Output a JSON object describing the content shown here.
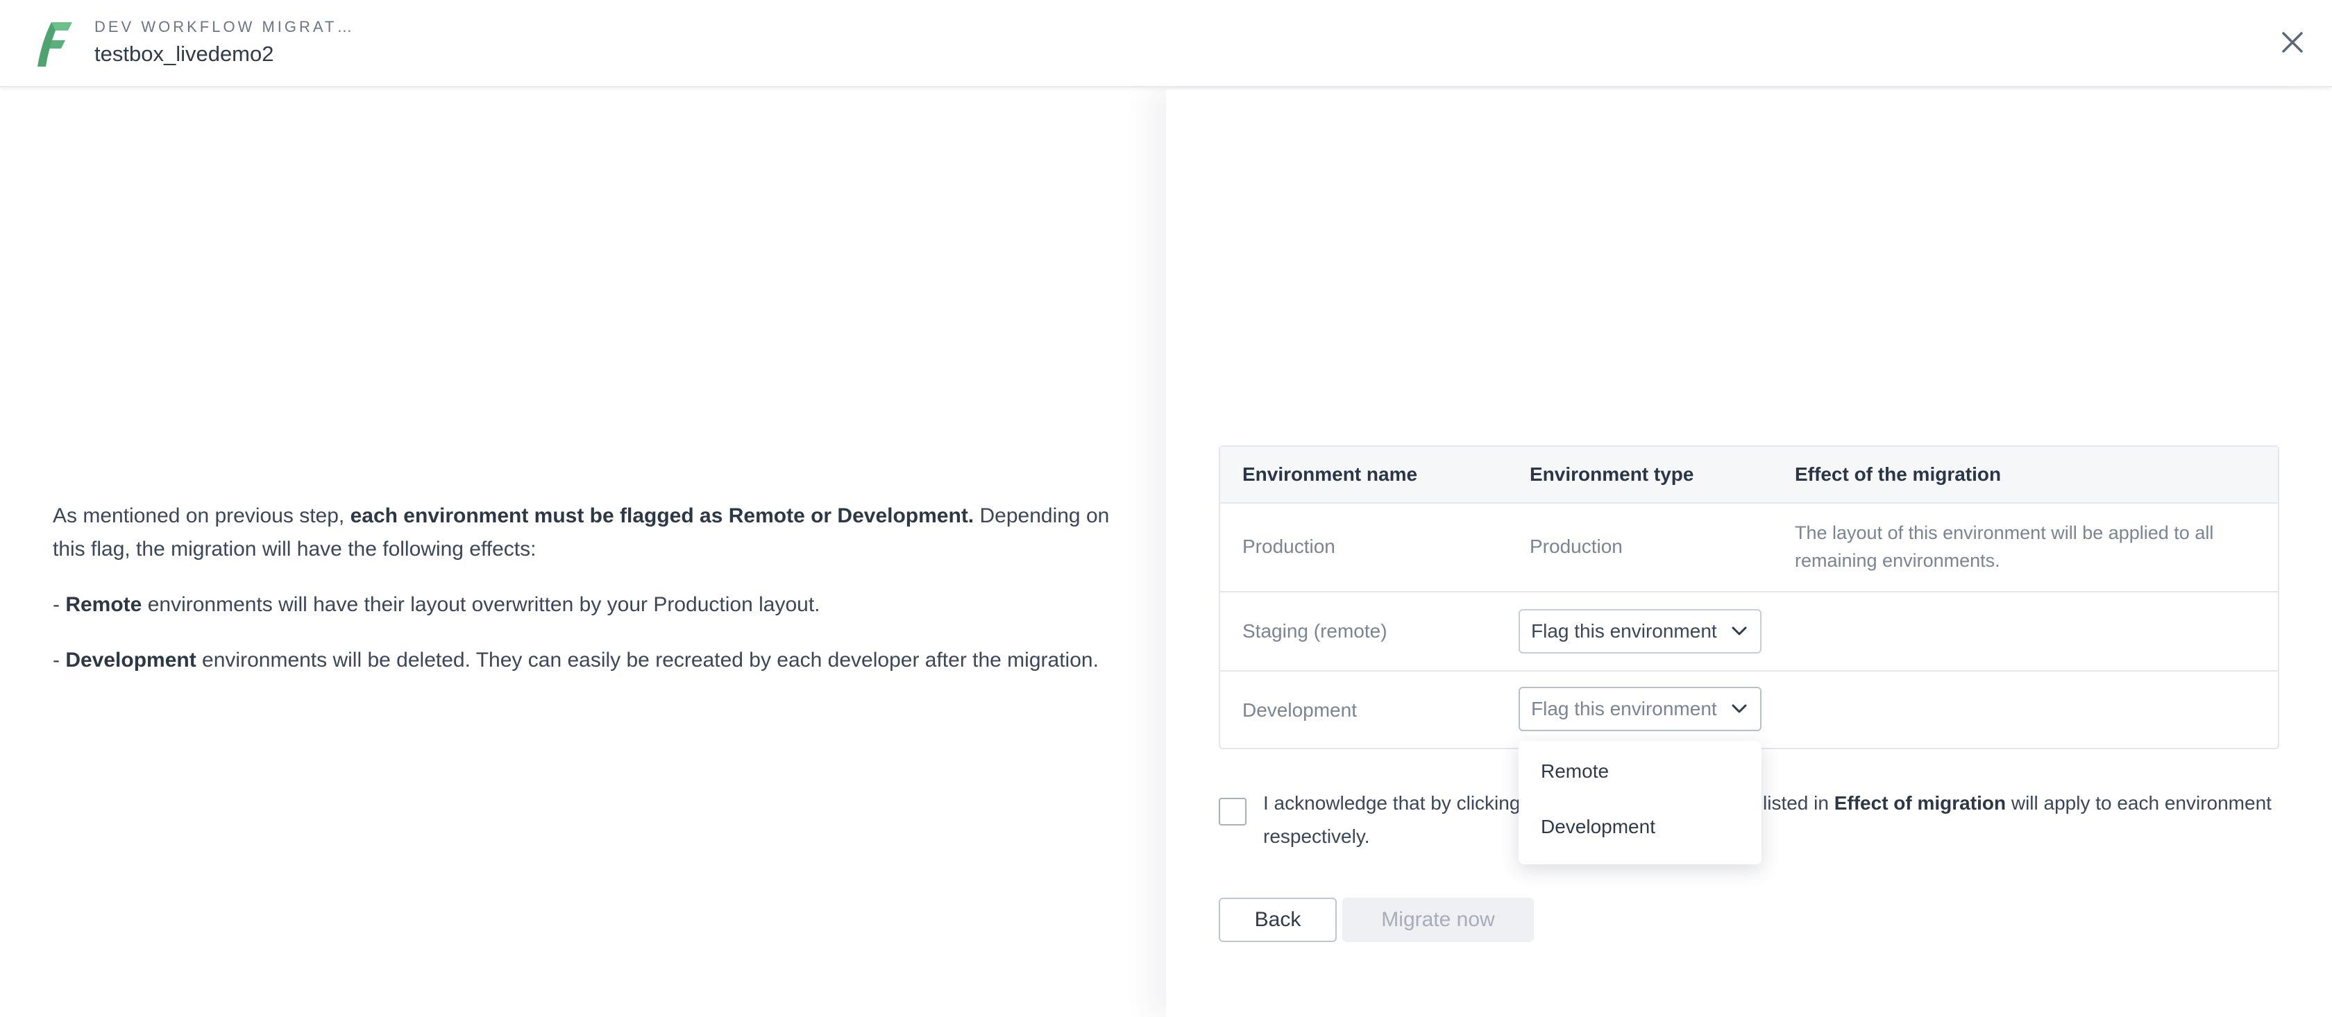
{
  "header": {
    "subtitle": "DEV WORKFLOW MIGRAT…",
    "title": "testbox_livedemo2",
    "brand_color": "#5ab07a",
    "logo_icon": "f-logo-icon",
    "close_icon": "close-icon"
  },
  "intro": {
    "p1_pre": "As mentioned on previous step, ",
    "p1_bold": "each environment must be flagged as Remote or Development.",
    "p1_post": " Depending on this flag, the migration will have the following effects:",
    "p2_dash": "- ",
    "p2_bold": "Remote",
    "p2_post": " environments will have their layout overwritten by your Production layout.",
    "p3_dash": "- ",
    "p3_bold": "Development",
    "p3_post": " environments will be deleted. They can easily be recreated by each developer after the migration."
  },
  "table": {
    "headers": [
      "Environment name",
      "Environment type",
      "Effect of the migration"
    ],
    "rows": [
      {
        "name": "Production",
        "type": "Production",
        "effect": "The layout of this environment will be applied to all remaining environments."
      },
      {
        "name": "Staging (remote)",
        "type_select": "Flag this environment",
        "effect": ""
      },
      {
        "name": "Development",
        "type_select": "Flag this environment",
        "effect": ""
      }
    ]
  },
  "dropdown": {
    "options": [
      "Remote",
      "Development"
    ]
  },
  "acknowledge": {
    "text_a": "I acknowledge that by clicking",
    "text_b_pre": "listed in ",
    "text_b_bold": "Effect of migration",
    "text_b_post": " will apply to each environment",
    "text_c": "respectively."
  },
  "buttons": {
    "back": "Back",
    "migrate": "Migrate now"
  }
}
